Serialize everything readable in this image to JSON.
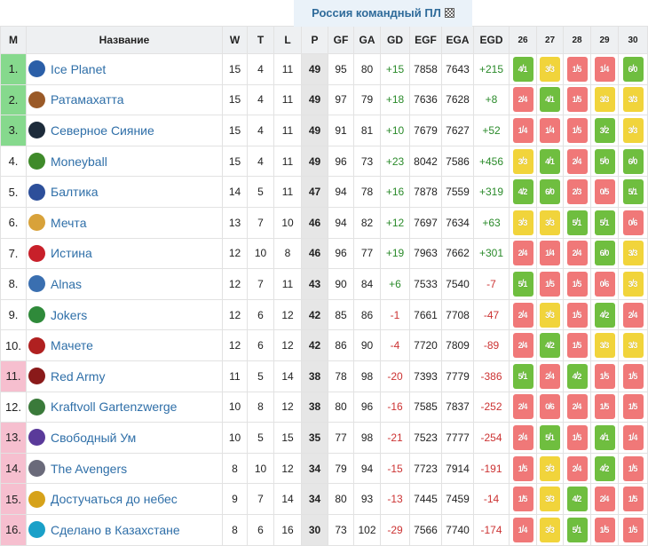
{
  "title": "Россия командный ПЛ",
  "header": {
    "pos": "М",
    "name": "Название",
    "w": "W",
    "t": "T",
    "l": "L",
    "p": "P",
    "gf": "GF",
    "ga": "GA",
    "gd": "GD",
    "egf": "EGF",
    "ega": "EGA",
    "egd": "EGD",
    "rounds": [
      "26",
      "27",
      "28",
      "29",
      "30"
    ]
  },
  "colors": {
    "win": "#6fbe3f",
    "loss": "#f07878",
    "draw": "#f1d43b",
    "top_zone": "#86d98d",
    "relegation_zone": "#f6bfcf",
    "link": "#2f6fa8"
  },
  "rows": [
    {
      "pos": "1.",
      "name": "Ice Planet",
      "icon": "ice-planet-logo",
      "zone": "g",
      "w": "15",
      "t": "4",
      "l": "11",
      "p": "49",
      "gf": "95",
      "ga": "80",
      "gd": "+15",
      "egf": "7858",
      "ega": "7643",
      "egd": "+215",
      "form": [
        {
          "a": "4",
          "b": "1",
          "r": "W"
        },
        {
          "a": "3",
          "b": "3",
          "r": "D"
        },
        {
          "a": "1",
          "b": "5",
          "r": "L"
        },
        {
          "a": "1",
          "b": "4",
          "r": "L"
        },
        {
          "a": "6",
          "b": "0",
          "r": "W"
        }
      ]
    },
    {
      "pos": "2.",
      "name": "Ратамахатта",
      "icon": "ratamahatta-logo",
      "zone": "g",
      "w": "15",
      "t": "4",
      "l": "11",
      "p": "49",
      "gf": "97",
      "ga": "79",
      "gd": "+18",
      "egf": "7636",
      "ega": "7628",
      "egd": "+8",
      "form": [
        {
          "a": "2",
          "b": "4",
          "r": "L"
        },
        {
          "a": "4",
          "b": "1",
          "r": "W"
        },
        {
          "a": "1",
          "b": "5",
          "r": "L"
        },
        {
          "a": "3",
          "b": "3",
          "r": "D"
        },
        {
          "a": "3",
          "b": "3",
          "r": "D"
        }
      ]
    },
    {
      "pos": "3.",
      "name": "Северное Сияние",
      "icon": "northern-lights-logo",
      "zone": "g",
      "w": "15",
      "t": "4",
      "l": "11",
      "p": "49",
      "gf": "91",
      "ga": "81",
      "gd": "+10",
      "egf": "7679",
      "ega": "7627",
      "egd": "+52",
      "form": [
        {
          "a": "1",
          "b": "4",
          "r": "L"
        },
        {
          "a": "1",
          "b": "4",
          "r": "L"
        },
        {
          "a": "1",
          "b": "5",
          "r": "L"
        },
        {
          "a": "3",
          "b": "2",
          "r": "W"
        },
        {
          "a": "3",
          "b": "3",
          "r": "D"
        }
      ]
    },
    {
      "pos": "4.",
      "name": "Moneyball",
      "icon": "moneyball-logo",
      "zone": "w",
      "w": "15",
      "t": "4",
      "l": "11",
      "p": "49",
      "gf": "96",
      "ga": "73",
      "gd": "+23",
      "egf": "8042",
      "ega": "7586",
      "egd": "+456",
      "form": [
        {
          "a": "3",
          "b": "3",
          "r": "D"
        },
        {
          "a": "4",
          "b": "1",
          "r": "W"
        },
        {
          "a": "2",
          "b": "4",
          "r": "L"
        },
        {
          "a": "5",
          "b": "0",
          "r": "W"
        },
        {
          "a": "6",
          "b": "0",
          "r": "W"
        }
      ]
    },
    {
      "pos": "5.",
      "name": "Балтика",
      "icon": "baltika-logo",
      "zone": "w",
      "w": "14",
      "t": "5",
      "l": "11",
      "p": "47",
      "gf": "94",
      "ga": "78",
      "gd": "+16",
      "egf": "7878",
      "ega": "7559",
      "egd": "+319",
      "form": [
        {
          "a": "4",
          "b": "2",
          "r": "W"
        },
        {
          "a": "6",
          "b": "0",
          "r": "W"
        },
        {
          "a": "2",
          "b": "3",
          "r": "L"
        },
        {
          "a": "0",
          "b": "5",
          "r": "L"
        },
        {
          "a": "5",
          "b": "1",
          "r": "W"
        }
      ]
    },
    {
      "pos": "6.",
      "name": "Мечта",
      "icon": "mechta-logo",
      "zone": "w",
      "w": "13",
      "t": "7",
      "l": "10",
      "p": "46",
      "gf": "94",
      "ga": "82",
      "gd": "+12",
      "egf": "7697",
      "ega": "7634",
      "egd": "+63",
      "form": [
        {
          "a": "3",
          "b": "3",
          "r": "D"
        },
        {
          "a": "3",
          "b": "3",
          "r": "D"
        },
        {
          "a": "5",
          "b": "1",
          "r": "W"
        },
        {
          "a": "5",
          "b": "1",
          "r": "W"
        },
        {
          "a": "0",
          "b": "6",
          "r": "L"
        }
      ]
    },
    {
      "pos": "7.",
      "name": "Истина",
      "icon": "truth-logo",
      "zone": "w",
      "w": "12",
      "t": "10",
      "l": "8",
      "p": "46",
      "gf": "96",
      "ga": "77",
      "gd": "+19",
      "egf": "7963",
      "ega": "7662",
      "egd": "+301",
      "form": [
        {
          "a": "2",
          "b": "4",
          "r": "L"
        },
        {
          "a": "1",
          "b": "4",
          "r": "L"
        },
        {
          "a": "2",
          "b": "4",
          "r": "L"
        },
        {
          "a": "6",
          "b": "0",
          "r": "W"
        },
        {
          "a": "3",
          "b": "3",
          "r": "D"
        }
      ]
    },
    {
      "pos": "8.",
      "name": "Alnas",
      "icon": "alnas-logo",
      "zone": "w",
      "w": "12",
      "t": "7",
      "l": "11",
      "p": "43",
      "gf": "90",
      "ga": "84",
      "gd": "+6",
      "egf": "7533",
      "ega": "7540",
      "egd": "-7",
      "form": [
        {
          "a": "5",
          "b": "1",
          "r": "W"
        },
        {
          "a": "1",
          "b": "5",
          "r": "L"
        },
        {
          "a": "1",
          "b": "5",
          "r": "L"
        },
        {
          "a": "0",
          "b": "6",
          "r": "L"
        },
        {
          "a": "3",
          "b": "3",
          "r": "D"
        }
      ]
    },
    {
      "pos": "9.",
      "name": "Jokers",
      "icon": "jokers-logo",
      "zone": "w",
      "w": "12",
      "t": "6",
      "l": "12",
      "p": "42",
      "gf": "85",
      "ga": "86",
      "gd": "-1",
      "egf": "7661",
      "ega": "7708",
      "egd": "-47",
      "form": [
        {
          "a": "2",
          "b": "4",
          "r": "L"
        },
        {
          "a": "3",
          "b": "3",
          "r": "D"
        },
        {
          "a": "1",
          "b": "5",
          "r": "L"
        },
        {
          "a": "4",
          "b": "2",
          "r": "W"
        },
        {
          "a": "2",
          "b": "4",
          "r": "L"
        }
      ]
    },
    {
      "pos": "10.",
      "name": "Мачете",
      "icon": "machete-logo",
      "zone": "w",
      "w": "12",
      "t": "6",
      "l": "12",
      "p": "42",
      "gf": "86",
      "ga": "90",
      "gd": "-4",
      "egf": "7720",
      "ega": "7809",
      "egd": "-89",
      "form": [
        {
          "a": "2",
          "b": "4",
          "r": "L"
        },
        {
          "a": "4",
          "b": "2",
          "r": "W"
        },
        {
          "a": "1",
          "b": "5",
          "r": "L"
        },
        {
          "a": "3",
          "b": "3",
          "r": "D"
        },
        {
          "a": "3",
          "b": "3",
          "r": "D"
        }
      ]
    },
    {
      "pos": "11.",
      "name": "Red Army",
      "icon": "red-army-logo",
      "zone": "r",
      "w": "11",
      "t": "5",
      "l": "14",
      "p": "38",
      "gf": "78",
      "ga": "98",
      "gd": "-20",
      "egf": "7393",
      "ega": "7779",
      "egd": "-386",
      "form": [
        {
          "a": "5",
          "b": "1",
          "r": "W"
        },
        {
          "a": "2",
          "b": "4",
          "r": "L"
        },
        {
          "a": "4",
          "b": "2",
          "r": "W"
        },
        {
          "a": "1",
          "b": "5",
          "r": "L"
        },
        {
          "a": "1",
          "b": "5",
          "r": "L"
        }
      ]
    },
    {
      "pos": "12.",
      "name": "Kraftvoll Gartenzwerge",
      "icon": "gnome-logo",
      "zone": "w",
      "w": "10",
      "t": "8",
      "l": "12",
      "p": "38",
      "gf": "80",
      "ga": "96",
      "gd": "-16",
      "egf": "7585",
      "ega": "7837",
      "egd": "-252",
      "form": [
        {
          "a": "2",
          "b": "4",
          "r": "L"
        },
        {
          "a": "0",
          "b": "6",
          "r": "L"
        },
        {
          "a": "2",
          "b": "4",
          "r": "L"
        },
        {
          "a": "1",
          "b": "5",
          "r": "L"
        },
        {
          "a": "1",
          "b": "5",
          "r": "L"
        }
      ]
    },
    {
      "pos": "13.",
      "name": "Свободный Ум",
      "icon": "free-mind-logo",
      "zone": "r",
      "w": "10",
      "t": "5",
      "l": "15",
      "p": "35",
      "gf": "77",
      "ga": "98",
      "gd": "-21",
      "egf": "7523",
      "ega": "7777",
      "egd": "-254",
      "form": [
        {
          "a": "2",
          "b": "4",
          "r": "L"
        },
        {
          "a": "5",
          "b": "1",
          "r": "W"
        },
        {
          "a": "1",
          "b": "5",
          "r": "L"
        },
        {
          "a": "4",
          "b": "1",
          "r": "W"
        },
        {
          "a": "1",
          "b": "4",
          "r": "L"
        }
      ]
    },
    {
      "pos": "14.",
      "name": "The Avengers",
      "icon": "avengers-logo",
      "zone": "r",
      "w": "8",
      "t": "10",
      "l": "12",
      "p": "34",
      "gf": "79",
      "ga": "94",
      "gd": "-15",
      "egf": "7723",
      "ega": "7914",
      "egd": "-191",
      "form": [
        {
          "a": "1",
          "b": "5",
          "r": "L"
        },
        {
          "a": "3",
          "b": "3",
          "r": "D"
        },
        {
          "a": "2",
          "b": "4",
          "r": "L"
        },
        {
          "a": "4",
          "b": "2",
          "r": "W"
        },
        {
          "a": "1",
          "b": "5",
          "r": "L"
        }
      ]
    },
    {
      "pos": "15.",
      "name": "Достучаться до небес",
      "icon": "heaven-logo",
      "zone": "r",
      "w": "9",
      "t": "7",
      "l": "14",
      "p": "34",
      "gf": "80",
      "ga": "93",
      "gd": "-13",
      "egf": "7445",
      "ega": "7459",
      "egd": "-14",
      "form": [
        {
          "a": "1",
          "b": "5",
          "r": "L"
        },
        {
          "a": "3",
          "b": "3",
          "r": "D"
        },
        {
          "a": "4",
          "b": "2",
          "r": "W"
        },
        {
          "a": "2",
          "b": "4",
          "r": "L"
        },
        {
          "a": "1",
          "b": "5",
          "r": "L"
        }
      ]
    },
    {
      "pos": "16.",
      "name": "Сделано в Казахстане",
      "icon": "kazakhstan-logo",
      "zone": "r",
      "w": "8",
      "t": "6",
      "l": "16",
      "p": "30",
      "gf": "73",
      "ga": "102",
      "gd": "-29",
      "egf": "7566",
      "ega": "7740",
      "egd": "-174",
      "form": [
        {
          "a": "1",
          "b": "4",
          "r": "L"
        },
        {
          "a": "3",
          "b": "3",
          "r": "D"
        },
        {
          "a": "5",
          "b": "1",
          "r": "W"
        },
        {
          "a": "1",
          "b": "5",
          "r": "L"
        },
        {
          "a": "1",
          "b": "5",
          "r": "L"
        }
      ]
    }
  ]
}
